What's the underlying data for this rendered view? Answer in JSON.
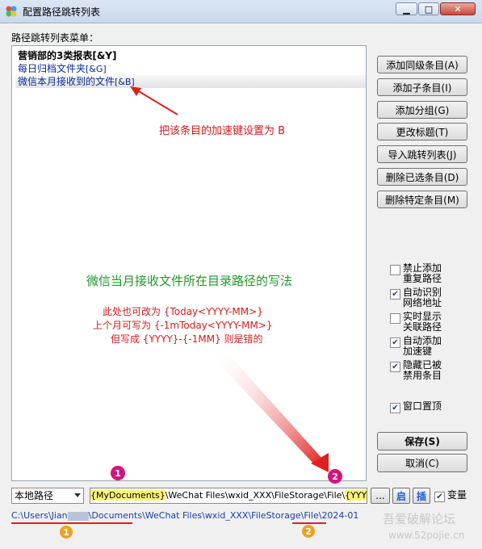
{
  "window": {
    "title": "配置路径跳转列表"
  },
  "menu_label": "路径跳转列表菜单：",
  "tree_items": [
    {
      "text": "营销部的3类报表",
      "shortcut": "[&Y]"
    },
    {
      "text": "每日归档文件夹",
      "shortcut": "[&G]"
    },
    {
      "text": "微信本月接收到的文件",
      "shortcut": "[&B]"
    }
  ],
  "buttons": {
    "add_sibling": "添加同级条目(A)",
    "add_child": "添加子条目(I)",
    "add_group": "添加分组(G)",
    "change_title": "更改标题(T)",
    "import_list": "导入跳转列表(J)",
    "delete_selected": "删除已选条目(D)",
    "delete_specific": "删除特定条目(M)",
    "save": "保存(S)",
    "cancel": "取消(C)"
  },
  "options": [
    {
      "label": "禁止添加重复路径",
      "checked": false
    },
    {
      "label": "自动识别网络地址",
      "checked": true
    },
    {
      "label": "实时显示关联路径",
      "checked": false
    },
    {
      "label": "自动添加加速键",
      "checked": true
    },
    {
      "label": "隐藏已被禁用条目",
      "checked": true
    },
    {
      "label": "窗口置顶",
      "checked": true
    }
  ],
  "annotations": {
    "hotkey_note": "把该条目的加速键设置为 B",
    "green_note": "微信当月接收文件所在目录路径的写法",
    "line1": "此处也可改为 {Today<YYYY-MM>}",
    "line2": "上个月可写为 {-1mToday<YYYY-MM>}",
    "line3": "但写成 {YYYY}-{-1MM} 则是错的"
  },
  "path_type": "本地路径",
  "path_parts": {
    "p1": "{MyDocuments}",
    "p2": "\\WeChat Files\\wxid_XXX\\FileStorage\\File\\",
    "p3": "{YYYY}-{MM}"
  },
  "browse_label": "...",
  "start_label": "启",
  "insert_label": "插",
  "variable_label": "变量",
  "variable_checked": true,
  "resolved": {
    "r1": "C:\\Users\\Jian",
    "r2": "\\Documents",
    "r3": "\\WeChat Files\\wxid_XXX\\FileStorage\\File\\",
    "r4": "2024-01"
  },
  "badges": [
    "1",
    "2",
    "1",
    "2"
  ],
  "watermark": {
    "line1": "吾爱破解论坛",
    "line2": "www.52pojie.cn"
  },
  "colors": {
    "accent_red": "#d81b1b",
    "green": "#1c9a2a",
    "pink": "#d4137f",
    "orange": "#f0a020",
    "highlight": "#fff37a"
  }
}
